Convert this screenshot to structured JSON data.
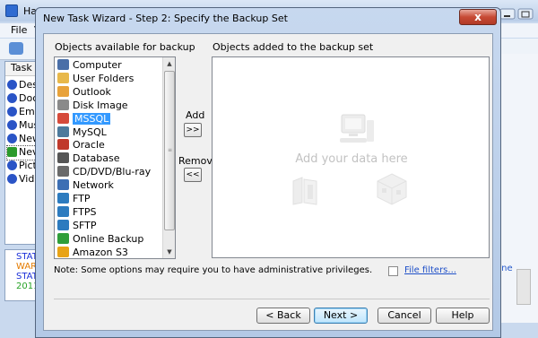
{
  "background_window": {
    "title": "Han",
    "menu": [
      "File",
      "V"
    ],
    "list_header": "Task na",
    "tasks": [
      "Des",
      "Doc",
      "Ema",
      "Mus",
      "New",
      "Nev",
      "Pict",
      "Vide"
    ],
    "log_lines": [
      {
        "text": "STAT",
        "color": "#1a2fd8"
      },
      {
        "text": "WARN",
        "color": "#e47b00"
      },
      {
        "text": "STAT",
        "color": "#1a2fd8"
      },
      {
        "text": "2011-",
        "color": "#27a327"
      }
    ],
    "right_link": ".ne"
  },
  "dialog": {
    "title": "New Task Wizard - Step 2: Specify the Backup Set",
    "close_label": "x",
    "available_label": "Objects available for backup",
    "added_label": "Objects added to the backup set",
    "placeholder": "Add your data here",
    "sources": [
      {
        "label": "Computer",
        "icon": "computer-icon",
        "color": "#4a6fa8"
      },
      {
        "label": "User Folders",
        "icon": "user-folders-icon",
        "color": "#e8b84a"
      },
      {
        "label": "Outlook",
        "icon": "outlook-icon",
        "color": "#e8a23a"
      },
      {
        "label": "Disk Image",
        "icon": "disk-image-icon",
        "color": "#8a8a8a"
      },
      {
        "label": "MSSQL",
        "icon": "mssql-icon",
        "color": "#d64a3a",
        "selected": true
      },
      {
        "label": "MySQL",
        "icon": "mysql-icon",
        "color": "#4d7a9c"
      },
      {
        "label": "Oracle",
        "icon": "oracle-icon",
        "color": "#c0392b"
      },
      {
        "label": "Database",
        "icon": "database-icon",
        "color": "#555555"
      },
      {
        "label": "CD/DVD/Blu-ray",
        "icon": "disc-icon",
        "color": "#6a6a6a"
      },
      {
        "label": "Network",
        "icon": "network-icon",
        "color": "#3d6fb4"
      },
      {
        "label": "FTP",
        "icon": "ftp-icon",
        "color": "#2c7bbf"
      },
      {
        "label": "FTPS",
        "icon": "ftps-icon",
        "color": "#2c7bbf"
      },
      {
        "label": "SFTP",
        "icon": "sftp-icon",
        "color": "#2c7bbf"
      },
      {
        "label": "Online Backup",
        "icon": "online-backup-icon",
        "color": "#2f9e3a"
      },
      {
        "label": "Amazon S3",
        "icon": "amazon-s3-icon",
        "color": "#e8a317"
      }
    ],
    "add_label": "Add",
    "add_button": ">>",
    "remove_label": "Remove",
    "remove_button": "<<",
    "note": "Note: Some options may require you to have administrative privileges.",
    "file_filters": "File filters...",
    "buttons": {
      "back": "< Back",
      "next": "Next >",
      "cancel": "Cancel",
      "help": "Help"
    }
  }
}
